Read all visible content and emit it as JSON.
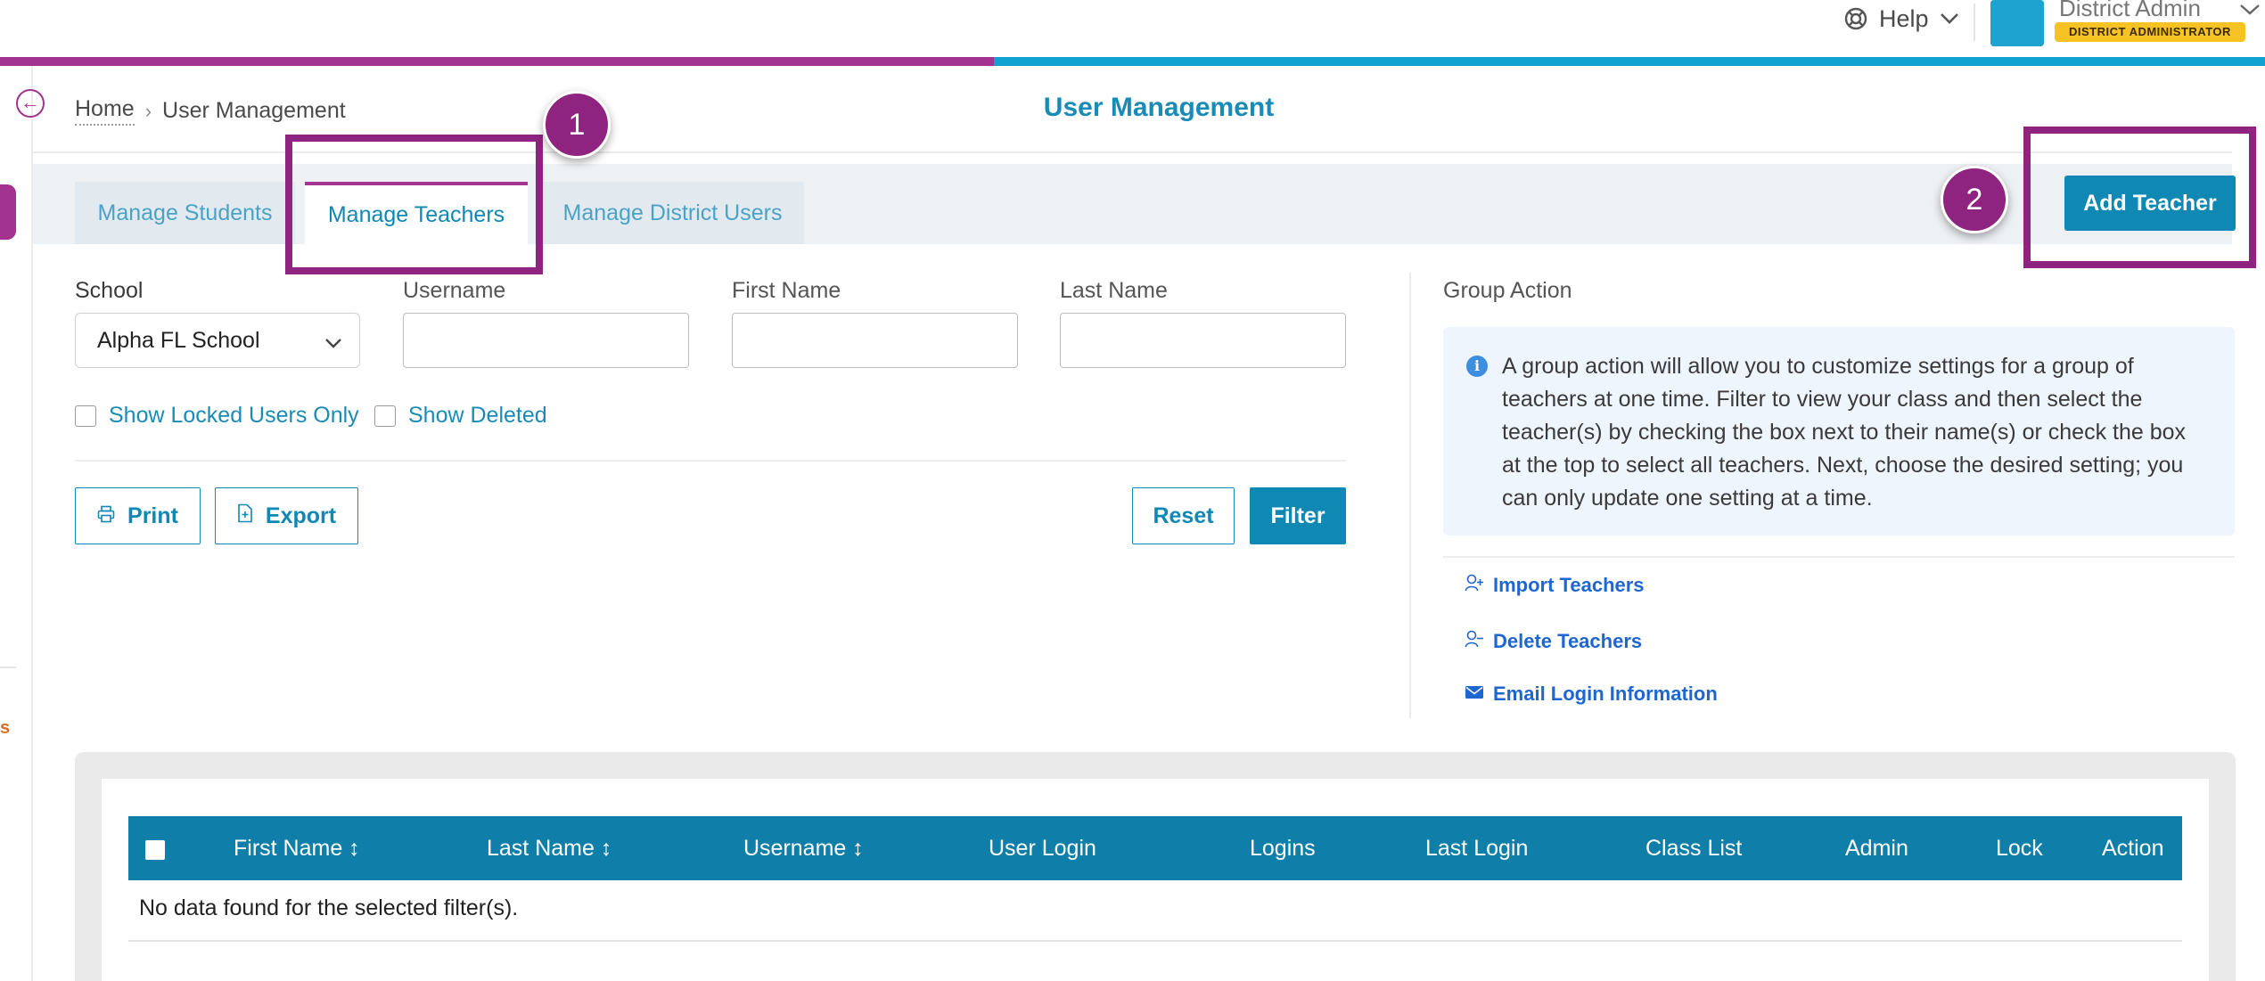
{
  "header": {
    "help_label": "Help",
    "user_name": "District Admin",
    "role_badge": "DISTRICT ADMINISTRATOR",
    "progress_fraction": 0.439
  },
  "breadcrumb": {
    "home": "Home",
    "current": "User Management"
  },
  "page_title": "User Management",
  "tabs": [
    {
      "label": "Manage Students",
      "active": false
    },
    {
      "label": "Manage Teachers",
      "active": true
    },
    {
      "label": "Manage District Users",
      "active": false
    }
  ],
  "annotations": {
    "step1": "1",
    "step2": "2",
    "highlight_color": "#8e2480"
  },
  "add_teacher_label": "Add Teacher",
  "filters": {
    "school_label": "School",
    "school_value": "Alpha FL School",
    "username_label": "Username",
    "username_value": "",
    "first_name_label": "First Name",
    "first_name_value": "",
    "last_name_label": "Last Name",
    "last_name_value": "",
    "show_locked_label": "Show Locked Users Only",
    "show_deleted_label": "Show Deleted",
    "print_label": "Print",
    "export_label": "Export",
    "reset_label": "Reset",
    "filter_label": "Filter"
  },
  "group_action": {
    "label": "Group Action",
    "info_text": "A group action will allow you to customize settings for a group of teachers at one time. Filter to view your class and then select the teacher(s) by checking the box next to their name(s) or check the box at the top to select all teachers. Next, choose the desired setting; you can only update one setting at a time.",
    "import_label": "Import Teachers",
    "delete_label": "Delete Teachers",
    "email_label": "Email Login Information"
  },
  "table": {
    "columns": [
      "First Name ↕",
      "Last Name ↕",
      "Username ↕",
      "User Login",
      "Logins",
      "Last Login",
      "Class List",
      "Admin",
      "Lock",
      "Action"
    ],
    "empty_message": "No data found for the selected filter(s)."
  },
  "colors": {
    "primary": "#0f88b4",
    "accent": "#a2338f",
    "table_header": "#0f7fa9",
    "link_blue": "#1e66d0"
  }
}
